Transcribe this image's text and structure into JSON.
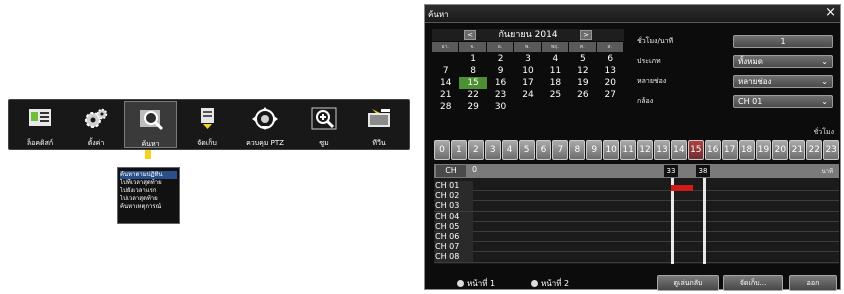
{
  "toolbar": {
    "items": [
      {
        "label": "ล็อคดิสก์",
        "icon": "disk-lock-icon"
      },
      {
        "label": "ตั้งค่า",
        "icon": "settings-gears-icon"
      },
      {
        "label": "ค้นหา",
        "icon": "search-magnifier-icon",
        "active": true
      },
      {
        "label": "จัดเก็บ",
        "icon": "backup-archive-icon"
      },
      {
        "label": "ควบคุม PTZ",
        "icon": "ptz-control-icon"
      },
      {
        "label": "ซูม",
        "icon": "zoom-icon"
      },
      {
        "label": "ทีวีน",
        "icon": "monitor-icon"
      }
    ],
    "submenu": [
      "ค้นหาตามปฏิทิน",
      "ไปที่เวลาสุดท้าย",
      "ไปยังเวลาแรก",
      "ไปเวลาสุดท้าย",
      "ค้นหาเหตุการณ์"
    ]
  },
  "window": {
    "title": "ค้นหา",
    "close": "×",
    "calendar": {
      "month_label": "กันยายน 2014",
      "prev": "<",
      "next": ">",
      "weekdays": [
        "อา.",
        "จ.",
        "อ.",
        "พ.",
        "พฤ.",
        "ศ.",
        "ส."
      ],
      "days": [
        "",
        "1",
        "2",
        "3",
        "4",
        "5",
        "6",
        "7",
        "8",
        "9",
        "10",
        "11",
        "12",
        "13",
        "14",
        "15",
        "16",
        "17",
        "18",
        "19",
        "20",
        "21",
        "22",
        "23",
        "24",
        "25",
        "26",
        "27",
        "28",
        "29",
        "30",
        "",
        "",
        "",
        ""
      ],
      "selected_day": "15"
    },
    "form": {
      "time_label": "ชั่วโมง/นาที",
      "time_value": "1",
      "type_label": "ประเภท",
      "type_value": "ทั้งหมด",
      "split_label": "หลายช่อง",
      "split_value": "หลายช่อง",
      "camera_label": "กล้อง",
      "camera_value": "CH 01"
    },
    "timeline": {
      "top_right_label": "ชั่วโมง",
      "hours": [
        "0",
        "1",
        "2",
        "3",
        "4",
        "5",
        "6",
        "7",
        "8",
        "9",
        "10",
        "11",
        "12",
        "13",
        "14",
        "15",
        "16",
        "17",
        "18",
        "19",
        "20",
        "21",
        "22",
        "23"
      ],
      "highlight_hour": "15",
      "ch_button": "CH",
      "start_min": "0",
      "marker_a": "33",
      "marker_b": "38",
      "end_label": "นาที",
      "channels": [
        "CH 01",
        "CH 02",
        "CH 03",
        "CH 04",
        "CH 05",
        "CH 06",
        "CH 07",
        "CH 08"
      ]
    },
    "footer": {
      "page1": "หน้าที่ 1",
      "page2": "หน้าที่ 2",
      "btn_play": "ดูเล่นกลับ",
      "btn_backup": "จัดเก็บ...",
      "btn_exit": "ออก"
    }
  }
}
